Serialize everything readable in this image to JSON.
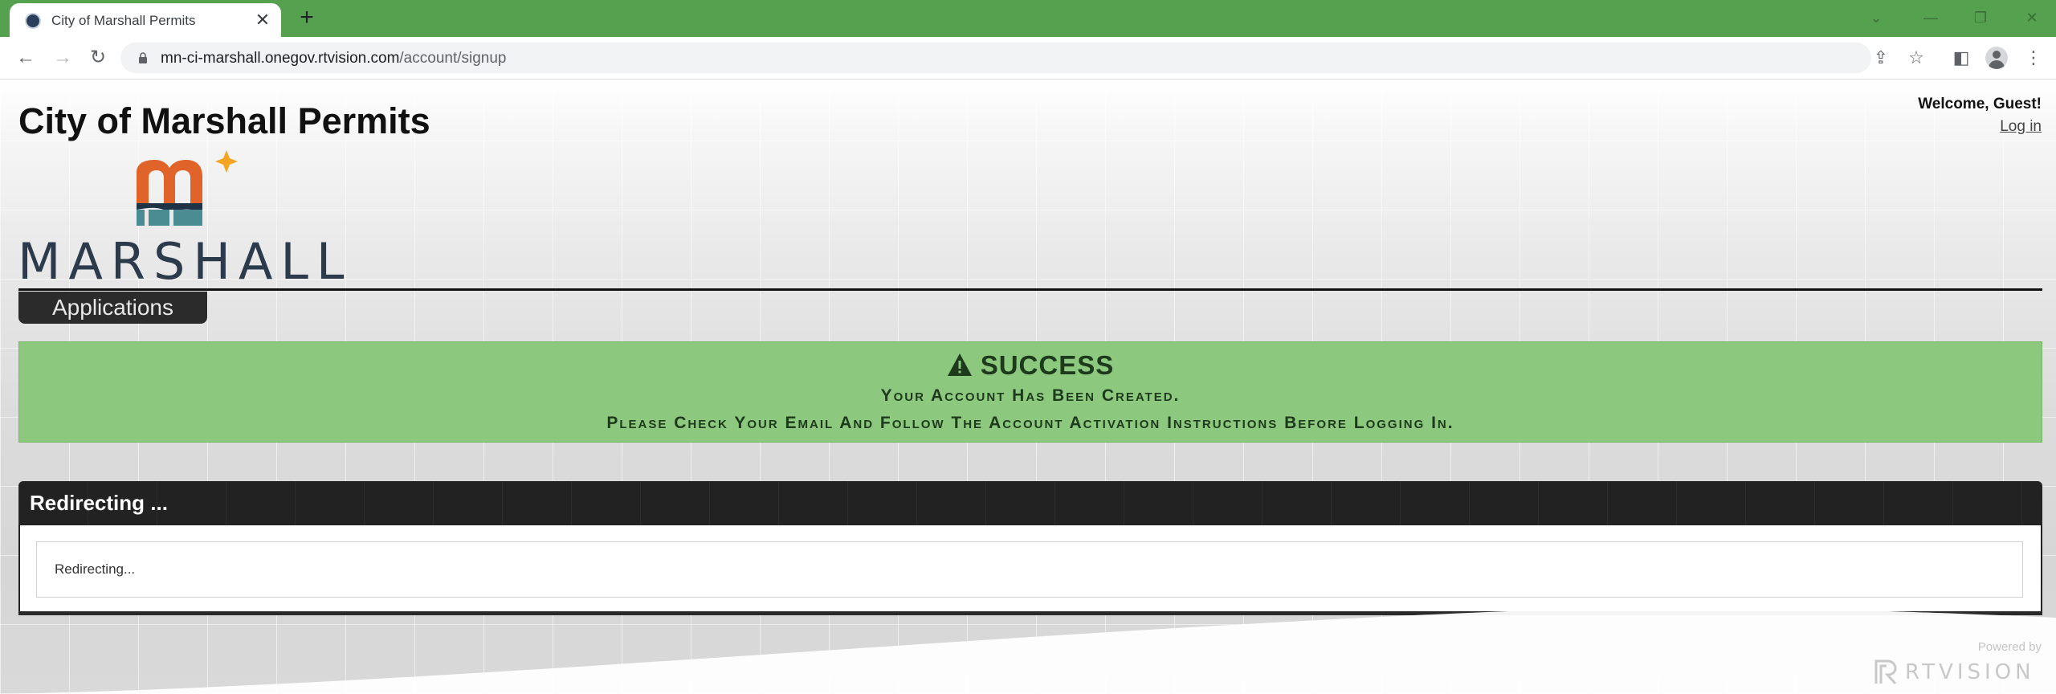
{
  "browser": {
    "tab_title": "City of Marshall Permits",
    "tab_close": "✕",
    "new_tab": "+",
    "url_host": "mn-ci-marshall.onegov.rtvision.com",
    "url_path": "/account/signup"
  },
  "header": {
    "site_title": "City of Marshall Permits",
    "logo_text": "MARSHALL",
    "welcome": "Welcome, Guest!",
    "login_link": "Log in"
  },
  "nav": {
    "applications_label": "Applications"
  },
  "alert": {
    "title": "SUCCESS",
    "line1": "Your Account Has Been Created.",
    "line2": "Please Check Your Email And Follow The Account Activation Instructions Before Logging In."
  },
  "panel": {
    "title": "Redirecting ...",
    "body": "Redirecting..."
  },
  "footer": {
    "powered_by": "Powered by",
    "brand": "RTVISION"
  },
  "colors": {
    "tabbar": "#55a14f",
    "success_bg": "#8cc87e",
    "panel_header": "#222222",
    "logo_orange": "#e0632a",
    "logo_teal": "#4a8c92",
    "logo_star": "#f4a623"
  }
}
